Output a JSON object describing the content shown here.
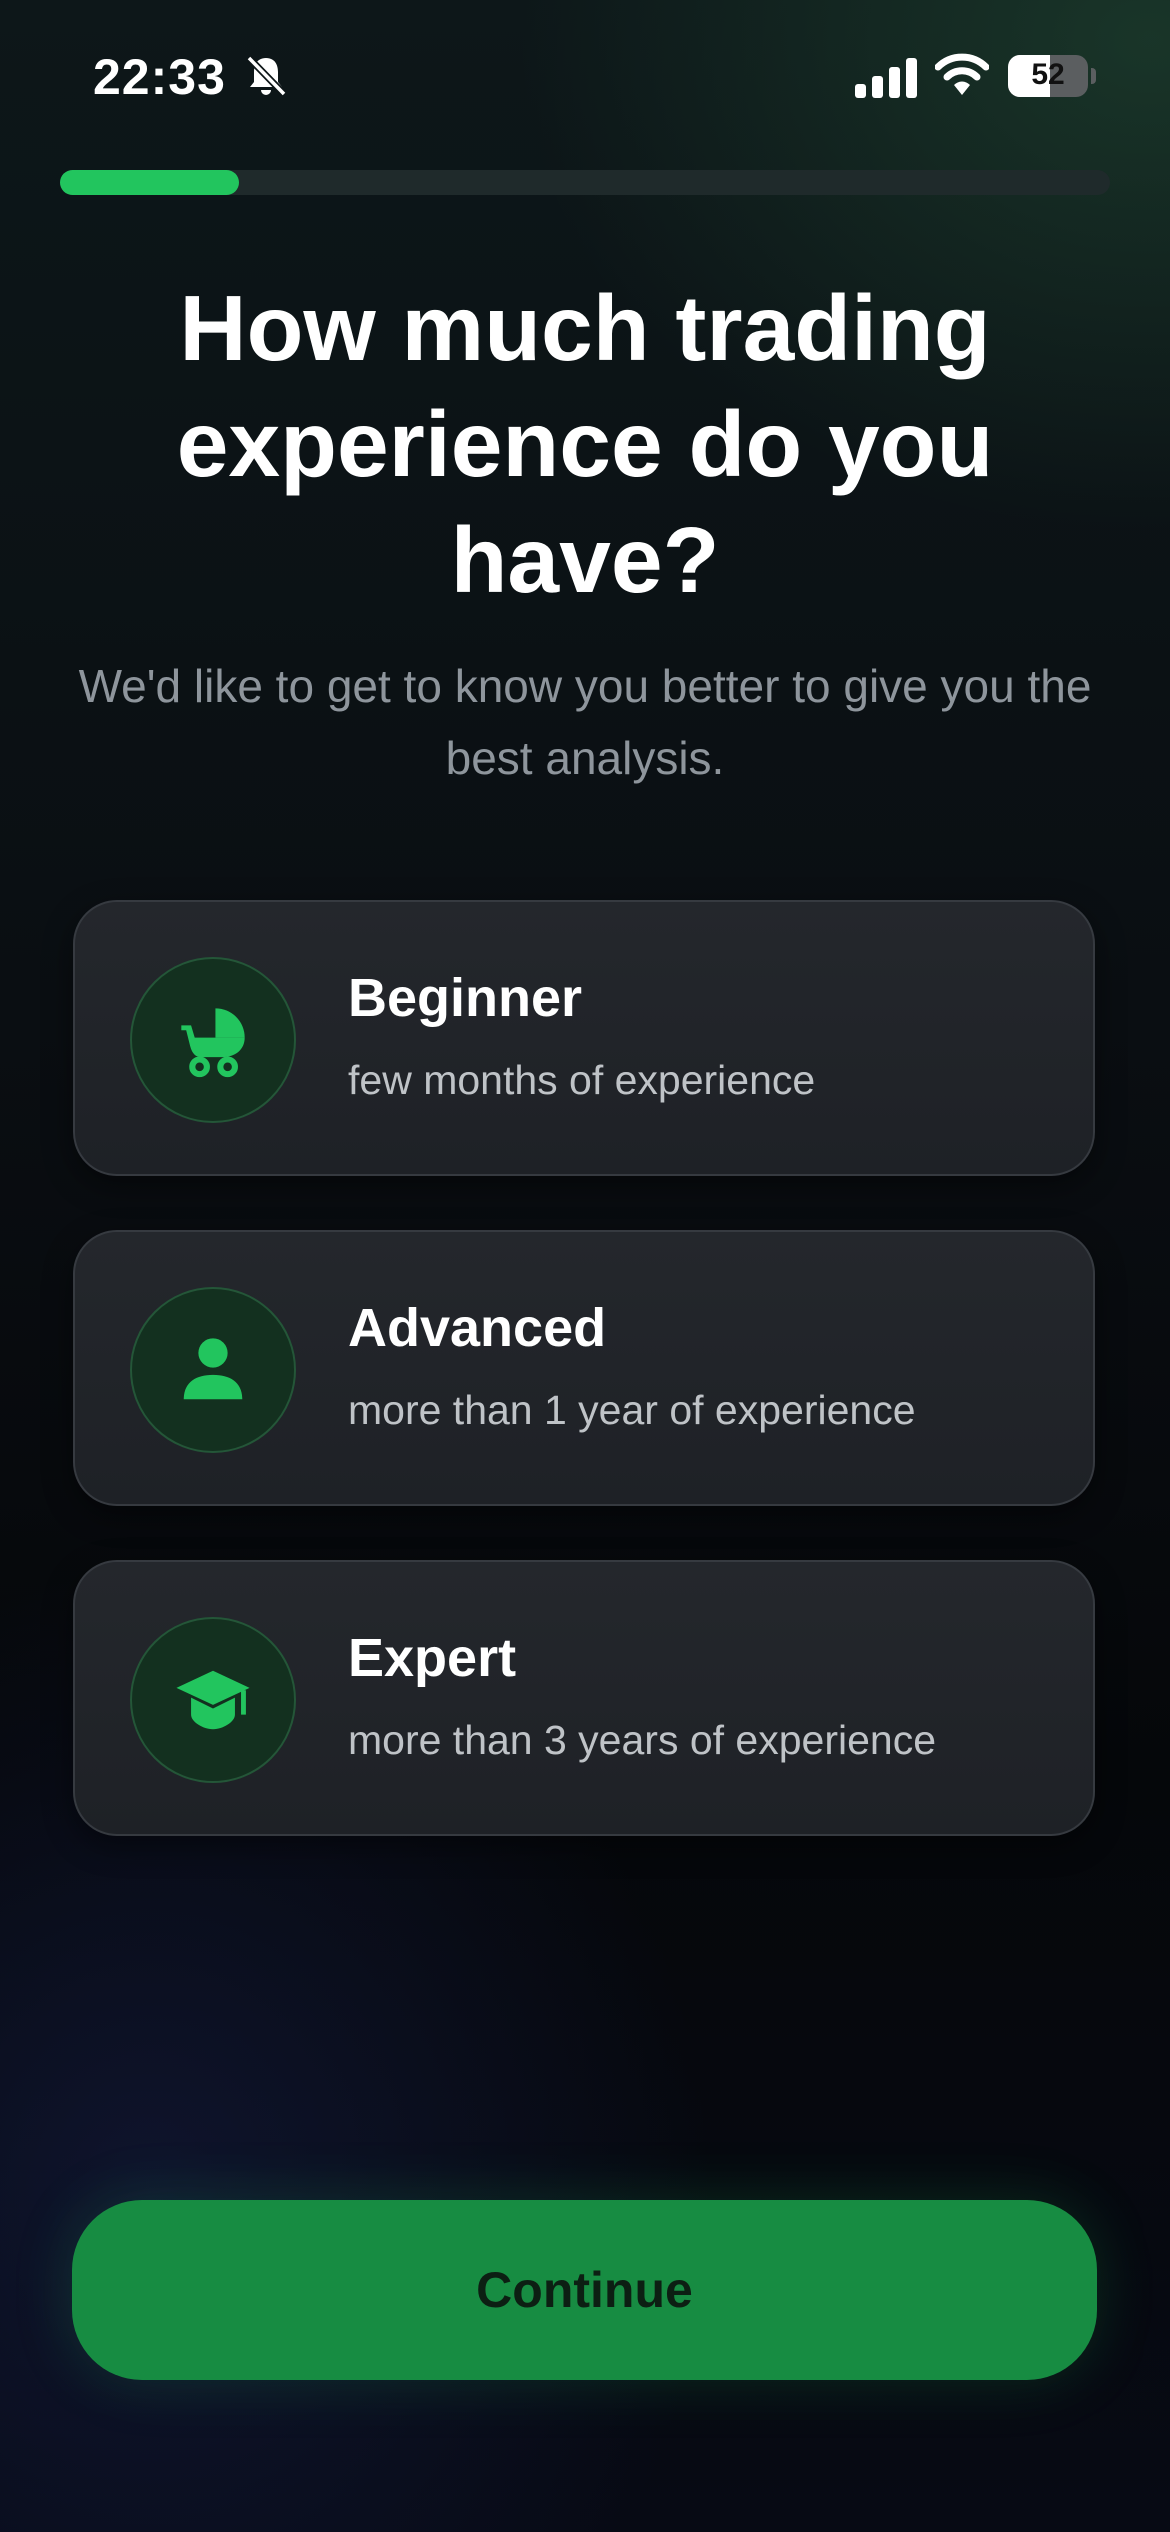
{
  "status_bar": {
    "time": "22:33",
    "battery": "52",
    "icons": [
      "bell-slash-icon",
      "cellular-signal-icon",
      "wifi-icon",
      "battery-icon"
    ]
  },
  "progress": {
    "value": 0.17
  },
  "header": {
    "title": "How much trading experience do you have?",
    "subtitle": "We'd like to get to know you better to give you the best analysis."
  },
  "options": [
    {
      "title": "Beginner",
      "subtitle": "few months of experience",
      "icon": "baby-carriage-icon"
    },
    {
      "title": "Advanced",
      "subtitle": "more than 1 year of experience",
      "icon": "user-icon"
    },
    {
      "title": "Expert",
      "subtitle": "more than 3 years of experience",
      "icon": "graduation-cap-icon"
    }
  ],
  "footer": {
    "continue_label": "Continue"
  },
  "colors": {
    "accent": "#22c55e",
    "button": "#178c42",
    "card": "#22252a",
    "background": "#06080a"
  }
}
